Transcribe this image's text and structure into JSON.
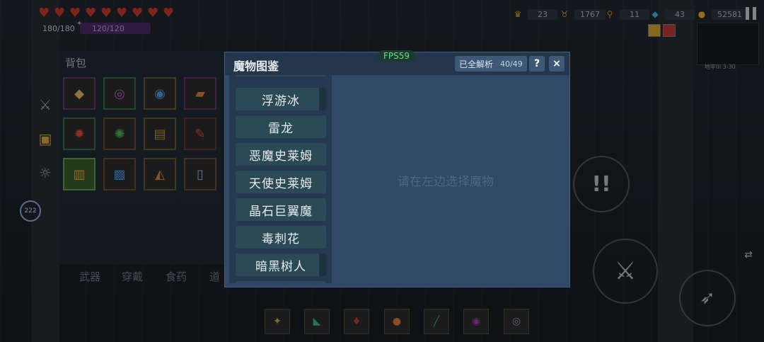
{
  "hud": {
    "hp": "180/180",
    "mp": "120/120",
    "resources": [
      {
        "icon": "crown-icon",
        "glyph": "♛",
        "color": "#d9a521",
        "value": "23"
      },
      {
        "icon": "horns-icon",
        "glyph": "♉",
        "color": "#c59a3b",
        "value": "1767"
      },
      {
        "icon": "key-icon",
        "glyph": "⚲",
        "color": "#d38b2a",
        "value": "11"
      },
      {
        "icon": "diamond-icon",
        "glyph": "◆",
        "color": "#3ab6e6",
        "value": "43"
      },
      {
        "icon": "coin-icon",
        "glyph": "●",
        "color": "#e0a82a",
        "value": "52581"
      }
    ],
    "level": "222"
  },
  "backpack": {
    "title": "背包",
    "tabs": [
      "武器",
      "穿戴",
      "食药",
      "道"
    ]
  },
  "minimap": {
    "floor_text": "地牢III 3-30"
  },
  "fps": "FPS59",
  "dialog": {
    "title": "魔物图鉴",
    "analysis_label": "已全解析",
    "analysis_count": "40/49",
    "help_label": "?",
    "close_label": "×",
    "placeholder": "请在左边选择魔物",
    "monsters": [
      "浮游冰",
      "雷龙",
      "恶魔史莱姆",
      "天使史莱姆",
      "晶石巨翼魔",
      "毒刺花",
      "暗黑树人"
    ]
  },
  "colors": {
    "dialog_bg": "#2f4a66",
    "header_bg": "#23364b",
    "item_bg": "#2b4a56",
    "fps_text": "#5fe08f"
  }
}
